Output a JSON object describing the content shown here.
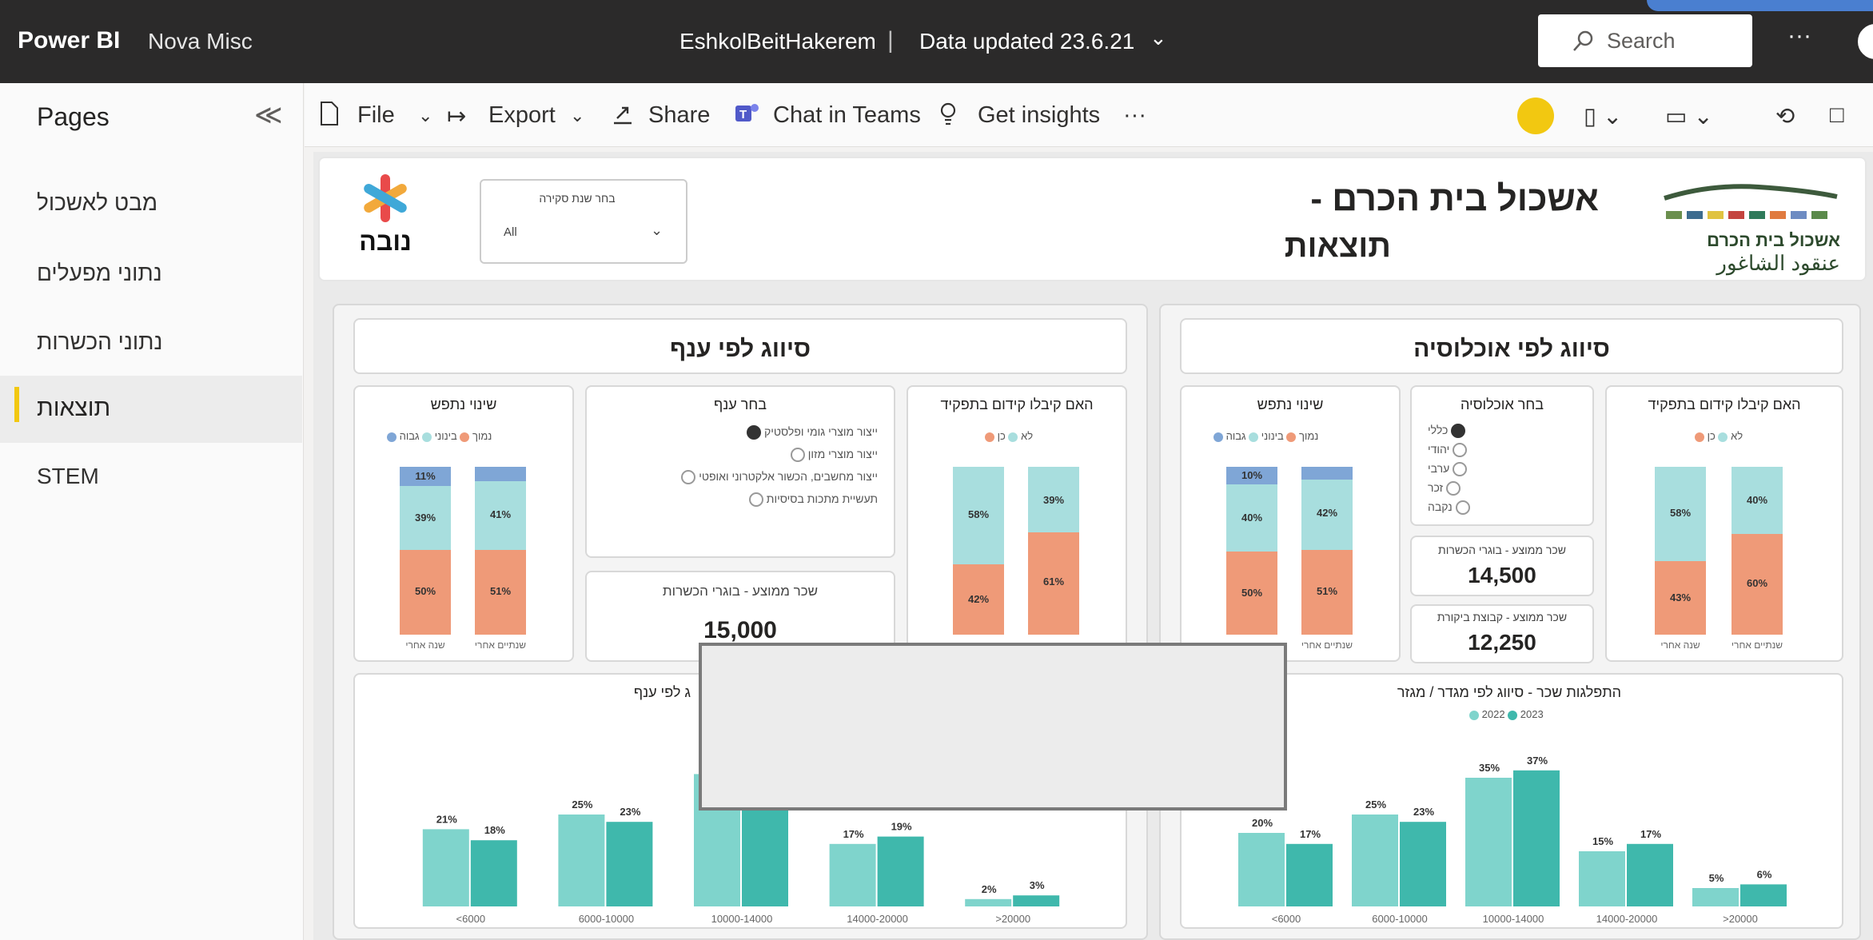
{
  "topbar": {
    "app": "Power BI",
    "workspace": "Nova Misc",
    "report": "EshkolBeitHakerem",
    "sep": "|",
    "updated": "Data updated 23.6.21",
    "search_placeholder": "Search",
    "more": "···"
  },
  "pages": {
    "header": "Pages",
    "collapse": "≪",
    "items": [
      "מבט לאשכול",
      "נתוני מפעלים",
      "נתוני הכשרות",
      "תוצאות",
      "STEM"
    ],
    "active_index": 3
  },
  "toolbar": {
    "file": "File",
    "export": "Export",
    "share": "Share",
    "teams": "Chat in Teams",
    "insights": "Get insights",
    "more": "···"
  },
  "report": {
    "title_line1": "אשכול בית הכרם -",
    "title_line2": "תוצאות",
    "logo_left_text": "נובה",
    "logo_right_he": "אשכול בית הכרם",
    "logo_right_ar": "عنقود الشاغور",
    "filter_label": "בחר שנת סקירה",
    "filter_value": "All",
    "left_section": "סיווג לפי ענף",
    "right_section": "סיווג לפי אוכלוסיה",
    "promo_title": "האם קיבלו קידום בתפקיד",
    "promo_legend": [
      "לא",
      "כן"
    ],
    "resp_title": "שינוי נתפש",
    "resp_legend": [
      "נמוך",
      "בינוני",
      "גבוה"
    ],
    "branch_title": "בחר ענף",
    "branch_options": [
      "ייצור מוצרי גומי ופלסטיק",
      "ייצור מוצרי מזון",
      "ייצור מחשבים, הכשור אלקטרוני ואופטי",
      "תעשיית מתכות בסיסיות"
    ],
    "pop_title": "בחר אוכלוסיה",
    "pop_options": [
      "כללי",
      "יהודי",
      "ערבי",
      "זכר",
      "נקבה"
    ],
    "salary_left_label": "שכר ממוצע - בוגרי הכשרות",
    "salary_left_value": "15,000",
    "salary_right1_label": "שכר ממוצע - בוגרי הכשרות",
    "salary_right1_value": "14,500",
    "salary_right2_label": "שכר ממוצע - קבוצת ביקורת",
    "salary_right2_value": "12,250",
    "dist_left_title_fragment": "ג לפי ענף",
    "dist_right_title": "התפלגות שכר - סיווג לפי מגדר / מגזר",
    "dist_legend": [
      "2022",
      "2023"
    ],
    "caption_a": "שנה אחרי",
    "caption_b": "שנתיים אחרי"
  },
  "colors": {
    "salmon": "#ef9a78",
    "aqua": "#a8dede",
    "blue": "#7fa6d6",
    "teal_light": "#7fd4cc",
    "teal_dark": "#3fb8ac",
    "accent": "#f2c811"
  },
  "chart_data": [
    {
      "type": "bar",
      "title": "האם קיבלו קידום בתפקיד",
      "panel": "branch",
      "categories": [
        "שנה אחרי",
        "שנתיים אחרי"
      ],
      "series": [
        {
          "name": "כן",
          "values": [
            42,
            61
          ]
        },
        {
          "name": "לא",
          "values": [
            58,
            39
          ]
        }
      ]
    },
    {
      "type": "bar",
      "title": "שינוי נתפש",
      "panel": "branch",
      "categories": [
        "שנה אחרי",
        "שנתיים אחרי"
      ],
      "series": [
        {
          "name": "נמוך",
          "values": [
            50,
            51
          ]
        },
        {
          "name": "בינוני",
          "values": [
            39,
            41
          ]
        },
        {
          "name": "גבוה",
          "values": [
            11,
            8
          ]
        }
      ]
    },
    {
      "type": "bar",
      "title": "האם קיבלו קידום בתפקיד",
      "panel": "population",
      "categories": [
        "שנה אחרי",
        "שנתיים אחרי"
      ],
      "series": [
        {
          "name": "כן",
          "values": [
            43,
            60
          ]
        },
        {
          "name": "לא",
          "values": [
            58,
            40
          ]
        }
      ]
    },
    {
      "type": "bar",
      "title": "שינוי נתפש",
      "panel": "population",
      "categories": [
        "שנה אחרי",
        "שנתיים אחרי"
      ],
      "series": [
        {
          "name": "נמוך",
          "values": [
            50,
            51
          ]
        },
        {
          "name": "בינוני",
          "values": [
            40,
            42
          ]
        },
        {
          "name": "גבוה",
          "values": [
            10,
            7
          ]
        }
      ]
    },
    {
      "type": "bar",
      "panel": "branch-distribution",
      "categories": [
        "<6000",
        "6000-10000",
        "10000-14000",
        "14000-20000",
        ">20000"
      ],
      "series": [
        {
          "name": "2022",
          "values": [
            21,
            25,
            36,
            17,
            2
          ]
        },
        {
          "name": "2023",
          "values": [
            18,
            23,
            36,
            19,
            3
          ]
        }
      ]
    },
    {
      "type": "bar",
      "title": "התפלגות שכר - סיווג לפי מגדר / מגזר",
      "panel": "population-distribution",
      "categories": [
        "<6000",
        "6000-10000",
        "10000-14000",
        "14000-20000",
        ">20000"
      ],
      "series": [
        {
          "name": "2022",
          "values": [
            20,
            25,
            35,
            15,
            5
          ]
        },
        {
          "name": "2023",
          "values": [
            17,
            23,
            37,
            17,
            6
          ]
        }
      ]
    }
  ]
}
